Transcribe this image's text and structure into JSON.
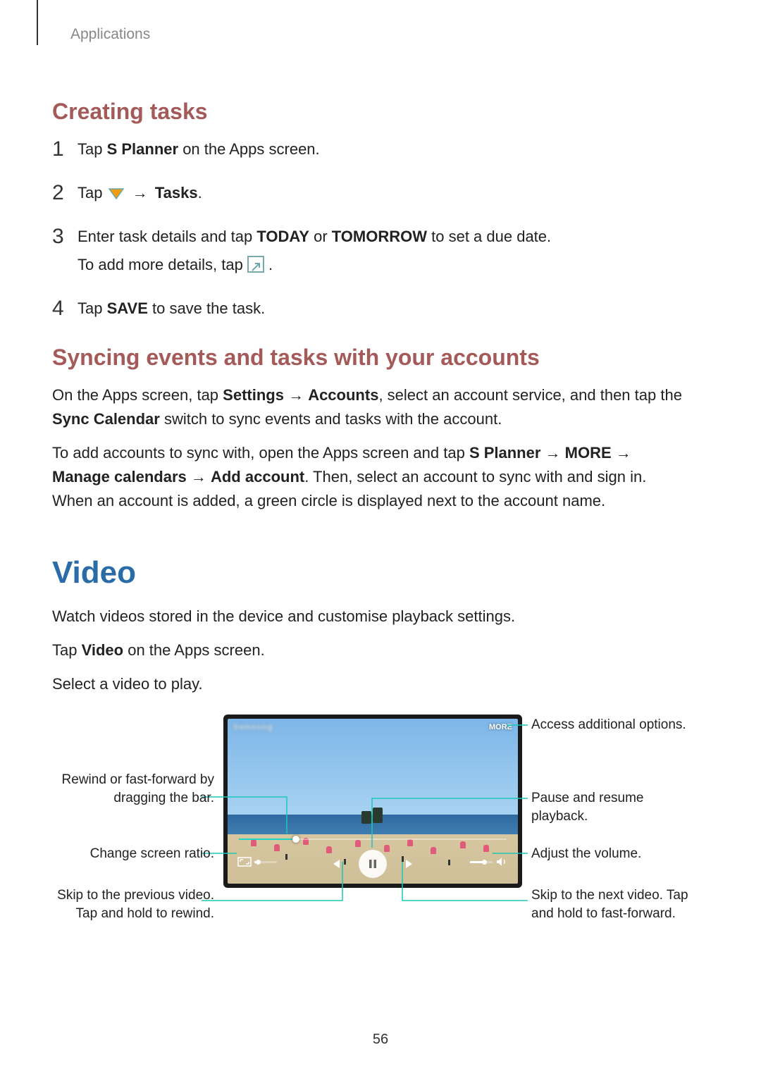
{
  "breadcrumb": "Applications",
  "page_number": "56",
  "section_creating_tasks": {
    "heading": "Creating tasks",
    "steps": [
      {
        "num": "1",
        "line1_pre": "Tap ",
        "line1_b1": "S Planner",
        "line1_post": " on the Apps screen."
      },
      {
        "num": "2",
        "line1_pre": "Tap ",
        "arrow": " → ",
        "line1_b1": "Tasks",
        "line1_post": "."
      },
      {
        "num": "3",
        "line1_pre": "Enter task details and tap ",
        "line1_b1": "TODAY",
        "line1_mid": " or ",
        "line1_b2": "TOMORROW",
        "line1_post": " to set a due date.",
        "line2_pre": "To add more details, tap ",
        "line2_post": "."
      },
      {
        "num": "4",
        "line1_pre": "Tap ",
        "line1_b1": "SAVE",
        "line1_post": " to save the task."
      }
    ]
  },
  "section_syncing": {
    "heading": "Syncing events and tasks with your accounts",
    "p1": {
      "t1": "On the Apps screen, tap ",
      "b1": "Settings",
      "arrow1": " → ",
      "b2": "Accounts",
      "t2": ", select an account service, and then tap the ",
      "b3": "Sync Calendar",
      "t3": " switch to sync events and tasks with the account."
    },
    "p2": {
      "t1": "To add accounts to sync with, open the Apps screen and tap ",
      "b1": "S Planner",
      "arrow1": " → ",
      "b2": "MORE",
      "arrow2": " → ",
      "b3": "Manage calendars",
      "arrow3": " → ",
      "b4": "Add account",
      "t2": ". Then, select an account to sync with and sign in. When an account is added, a green circle is displayed next to the account name."
    }
  },
  "section_video": {
    "heading": "Video",
    "p1": "Watch videos stored in the device and customise playback settings.",
    "p2_pre": "Tap ",
    "p2_b": "Video",
    "p2_post": " on the Apps screen.",
    "p3": "Select a video to play."
  },
  "diagram": {
    "topbar_brand": "Samsung",
    "topbar_more": "MORE",
    "callouts": {
      "rewind_bar": "Rewind or fast-forward by dragging the bar.",
      "screen_ratio": "Change screen ratio.",
      "prev_video": "Skip to the previous video. Tap and hold to rewind.",
      "more_options": "Access additional options.",
      "pause_resume": "Pause and resume playback.",
      "adjust_volume": "Adjust the volume.",
      "next_video": "Skip to the next video. Tap and hold to fast-forward."
    }
  }
}
